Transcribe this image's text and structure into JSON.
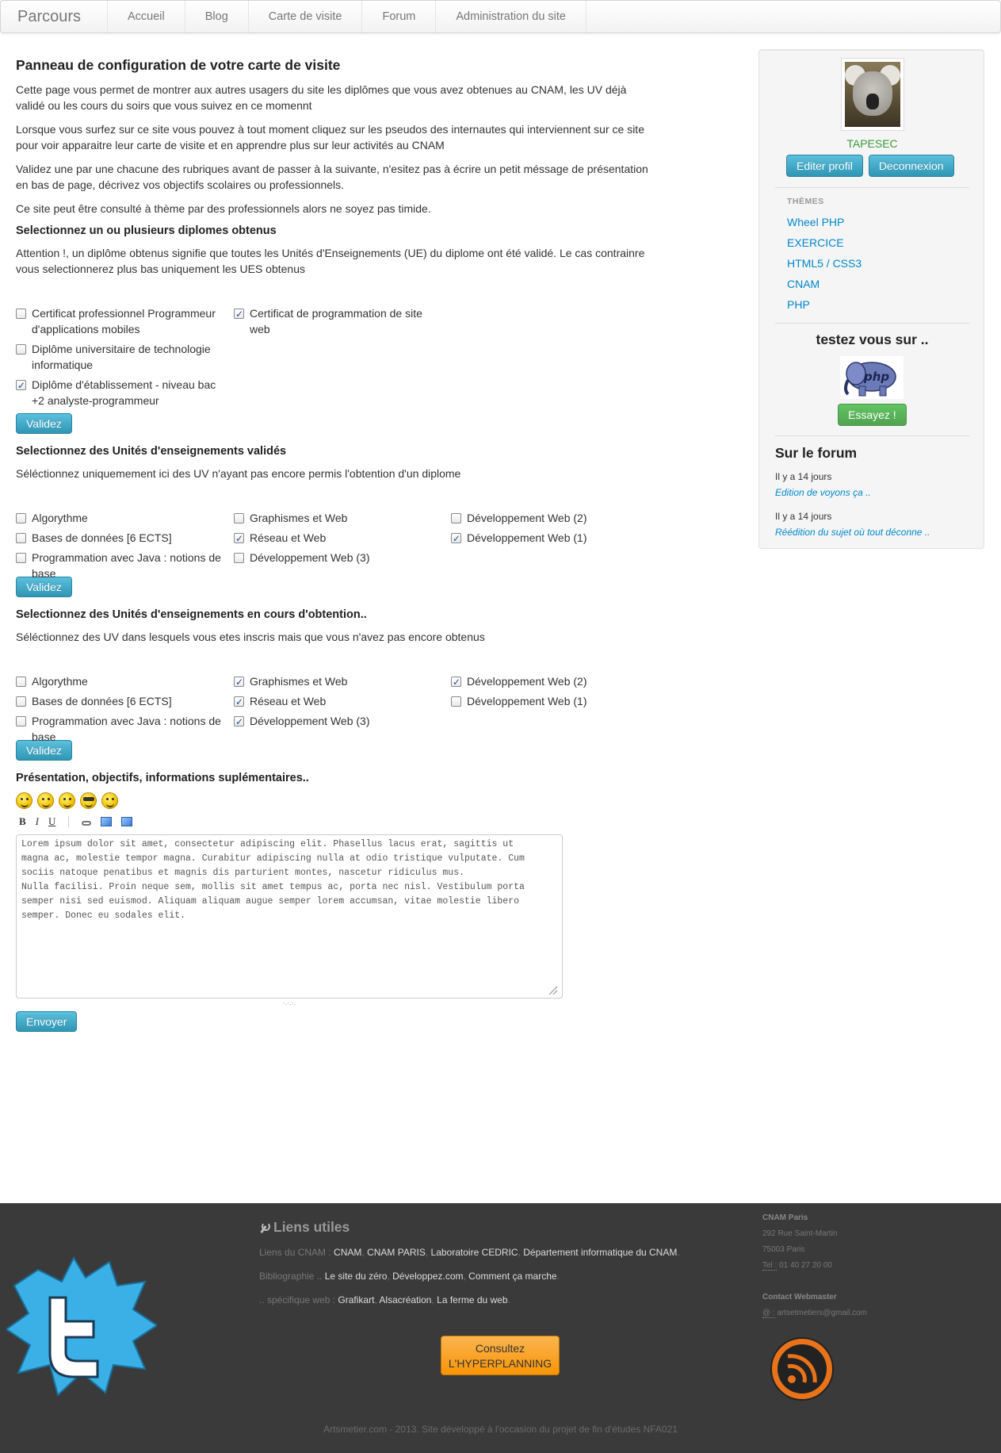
{
  "navbar": {
    "brand": "Parcours",
    "items": [
      "Accueil",
      "Blog",
      "Carte de visite",
      "Forum",
      "Administration du site"
    ]
  },
  "main": {
    "title": "Panneau de configuration de votre carte de visite",
    "paragraphs": [
      "Cette page vous permet de montrer aux autres usagers du site les diplômes que vous avez obtenues au CNAM, les UV déjà validé ou les cours du soirs que vous suivez en ce momennt",
      "Lorsque vous surfez sur ce site vous pouvez à tout moment cliquez sur les pseudos des internautes qui interviennent sur ce site pour voir apparaitre leur carte de visite et en apprendre plus sur leur activités au CNAM",
      "Validez une par une chacune des rubriques avant de passer à la suivante, n'esitez pas à écrire un petit méssage de présentation en bas de page, décrivez vos objectifs scolaires ou professionnels.",
      "Ce site peut être consulté à thème par des professionnels alors ne soyez pas timide."
    ],
    "diplomes": {
      "heading": "Selectionnez un ou plusieurs diplomes obtenus",
      "intro": "Attention !, un diplôme obtenus signifie que toutes les Unités d'Enseignements (UE) du diplome ont été validé. Le cas contrainre vous selectionnerez plus bas uniquement les UES obtenus",
      "items": [
        {
          "label": "Certificat professionnel Programmeur d'applications mobiles",
          "checked": false
        },
        {
          "label": "Certificat de programmation de site web",
          "checked": true
        },
        {
          "label": "Diplôme universitaire de technologie informatique",
          "checked": false
        },
        {
          "label": "Diplôme d'établissement - niveau bac +2 analyste-programmeur",
          "checked": true
        }
      ],
      "button": "Validez"
    },
    "uv_valides": {
      "heading": "Selectionnez des Unités d'enseignements validés",
      "intro": "Séléctionnez uniquemement ici des UV n'ayant pas encore permis l'obtention d'un diplome",
      "items": [
        {
          "label": "Algorythme",
          "checked": false
        },
        {
          "label": "Graphismes et Web",
          "checked": false
        },
        {
          "label": "Développement Web (2)",
          "checked": false
        },
        {
          "label": "Bases de données [6 ECTS]",
          "checked": false
        },
        {
          "label": "Réseau et Web",
          "checked": true
        },
        {
          "label": "Développement Web (1)",
          "checked": true
        },
        {
          "label": "Programmation avec Java : notions de base",
          "checked": false
        },
        {
          "label": "Développement Web (3)",
          "checked": false
        }
      ],
      "button": "Validez"
    },
    "uv_en_cours": {
      "heading": "Selectionnez des Unités d'enseignements en cours d'obtention..",
      "intro": "Séléctionnez des UV dans lesquels vous etes inscris mais que vous n'avez pas encore obtenus",
      "items": [
        {
          "label": "Algorythme",
          "checked": false
        },
        {
          "label": "Graphismes et Web",
          "checked": true
        },
        {
          "label": "Développement Web (2)",
          "checked": true
        },
        {
          "label": "Bases de données [6 ECTS]",
          "checked": false
        },
        {
          "label": "Réseau et Web",
          "checked": true
        },
        {
          "label": "Développement Web (1)",
          "checked": false
        },
        {
          "label": "Programmation avec Java : notions de base",
          "checked": false
        },
        {
          "label": "Développement Web (3)",
          "checked": true
        }
      ],
      "button": "Validez"
    },
    "presentation": {
      "heading": "Présentation, objectifs, informations suplémentaires..",
      "toolbar": {
        "bold": "B",
        "italic": "I",
        "underline": "U"
      },
      "editor_text": "Lorem ipsum dolor sit amet, consectetur adipiscing elit. Phasellus lacus erat, sagittis ut\nmagna ac, molestie tempor magna. Curabitur adipiscing nulla at odio tristique vulputate. Cum\nsociis natoque penatibus et magnis dis parturient montes, nascetur ridiculus mus.\nNulla facilisi. Proin neque sem, mollis sit amet tempus ac, porta nec nisl. Vestibulum porta\nsemper nisi sed euismod. Aliquam aliquam augue semper lorem accumsan, vitae molestie libero\nsemper. Donec eu sodales elit.",
      "resize_dots": "·.·.·.",
      "button": "Envoyer"
    }
  },
  "sidebar": {
    "username": "TAPESEC",
    "edit_button": "Editer profil",
    "logout_button": "Deconnexion",
    "themes_heading": "THÈMES",
    "themes": [
      "Wheel PHP",
      "EXERCICE",
      "HTML5 / CSS3",
      "CNAM",
      "PHP"
    ],
    "testez": "testez vous sur ..",
    "php_logo_text": "php",
    "essayez_button": "Essayez !",
    "forum_heading": "Sur le forum",
    "forum_posts": [
      {
        "date": "Il y a 14 jours",
        "title": "Edition de voyons ça .."
      },
      {
        "date": "Il y a 14 jours",
        "title": "Réédition du sujet où tout déconne .."
      }
    ]
  },
  "footer": {
    "links_heading": "Liens utiles",
    "rows": [
      {
        "prefix": "Liens du CNAM : ",
        "links": [
          "CNAM",
          "CNAM PARIS",
          "Laboratoire CEDRIC",
          "Département informatique du CNAM"
        ]
      },
      {
        "prefix": "Bibliographie .. ",
        "links": [
          "Le site du zéro",
          "Développez.com",
          "Comment ça marche"
        ]
      },
      {
        "prefix": ".. spécifique web : ",
        "links": [
          "Grafikart",
          "Alsacréation",
          "La ferme du web"
        ]
      }
    ],
    "hyperplanning_line1": "Consultez",
    "hyperplanning_line2": "L'HYPERPLANNING",
    "contact": {
      "org": "CNAM Paris",
      "street": "292 Rue Saint-Martin",
      "city": "75003 Paris",
      "tel_label": "Tel :",
      "tel": " 01 40 27 20 00",
      "webmaster_label": "Contact Webmaster",
      "email_label": "@ :",
      "email": " artsetmetiers@gmail.com"
    },
    "copyright": "Artsmetier.com - 2013. Site développé à l'occasion du projet de fin d'études NFA021"
  },
  "colors": {
    "link": "#0088cc",
    "btn_info": "#2f96b4",
    "btn_success": "#51a351",
    "btn_warning": "#f89406",
    "footer_bg": "#3a3a3a",
    "username": "#3a9a3a"
  }
}
